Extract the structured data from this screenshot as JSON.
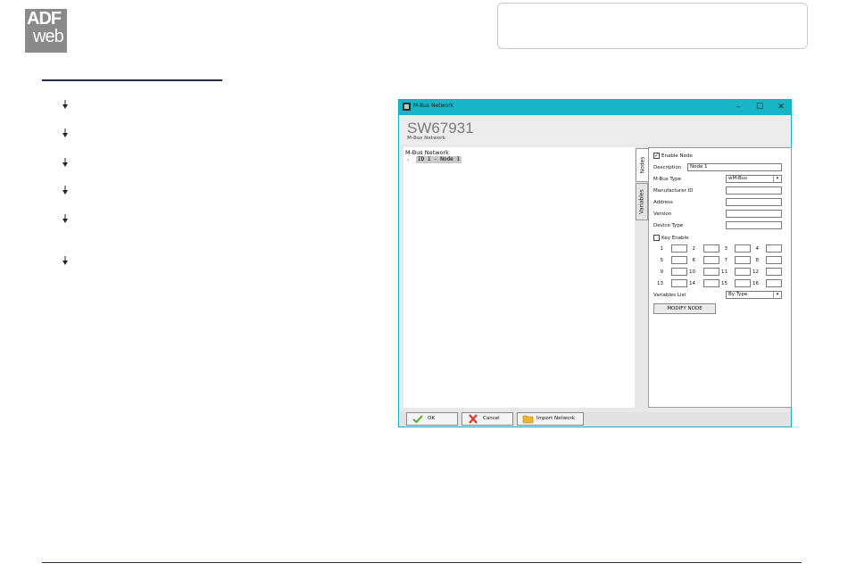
{
  "logo": {
    "line1": "ADF",
    "line2": "web"
  },
  "index": {
    "bullets": 6
  },
  "dialog": {
    "title": "M-Bus Network",
    "window_buttons": {
      "minimize": "–",
      "maximize": "☐",
      "close": "✕"
    },
    "header": {
      "title": "SW67931",
      "subtitle": "M-Bus Network"
    },
    "tree": {
      "root": "M-Bus Network",
      "expander": "›",
      "node": "ID 1 - Node 1"
    },
    "tabs": [
      {
        "label": "Nodes"
      },
      {
        "label": "Variables"
      }
    ],
    "form": {
      "enable_node_label": "Enable Node",
      "enable_node_checked": true,
      "check_mark": "✓",
      "description_label": "Description",
      "description_value": "Node 1",
      "mbus_type_label": "M-Bus Type",
      "mbus_type_value": "wM-Bus",
      "manufacturer_id_label": "Manufacturer ID",
      "manufacturer_id_value": "",
      "address_label": "Address",
      "address_value": "",
      "version_label": "Version",
      "version_value": "",
      "device_type_label": "Device Type",
      "device_type_value": "",
      "key_enable_label": "Key Enable",
      "key_enable_checked": false,
      "key_numbers": [
        "1",
        "2",
        "3",
        "4",
        "5",
        "6",
        "7",
        "8",
        "9",
        "10",
        "11",
        "12",
        "13",
        "14",
        "15",
        "16"
      ],
      "variables_list_label": "Variables List",
      "variables_list_value": "By Type",
      "dropdown_arrow": "▾",
      "modify_button": "MODIFY NODE"
    },
    "buttons": {
      "ok": "OK",
      "cancel": "Cancel",
      "import": "Import Network"
    },
    "icon_names": {
      "ok": "check-icon",
      "cancel": "cross-icon",
      "import": "folder-icon"
    },
    "colors": {
      "titlebar": "#18b5c6",
      "ok_icon": "#4caf2b",
      "cancel_icon": "#d9352a",
      "import_icon": "#e8b631"
    }
  }
}
